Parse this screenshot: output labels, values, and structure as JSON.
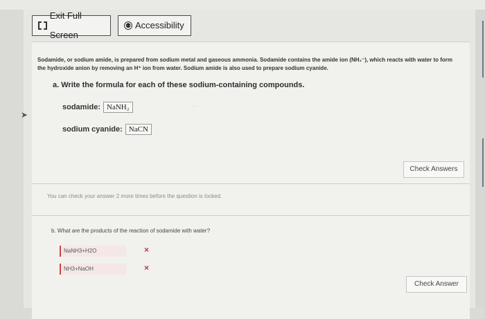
{
  "toolbar": {
    "exit_label": "Exit Full Screen",
    "accessibility_label": "Accessibility"
  },
  "question": {
    "intro": "Sodamide, or sodium amide, is prepared from sodium metal and gaseous ammonia. Sodamide contains the amide ion (NH₂⁻), which reacts with water to form the hydroxide anion by removing an H⁺ ion from water. Sodium amide is also used to prepare sodium cyanide.",
    "part_a": {
      "prompt": "a. Write the formula for each of these sodium-containing compounds.",
      "sodamide_label": "sodamide:",
      "sodamide_answer": "NaNH₂",
      "cyanide_label": "sodium cyanide:",
      "cyanide_answer": "NaCN"
    },
    "check_answers_label": "Check Answers",
    "attempts_notice": "You can check your answer 2 more times before the question is locked.",
    "part_b": {
      "prompt": "b. What are the products of the reaction of sodamide with water?",
      "responses": [
        "NaNH3+H2O",
        "NH3+NaOH"
      ],
      "marks": [
        "×",
        "×"
      ]
    },
    "check_answer_label": "Check Answer"
  }
}
